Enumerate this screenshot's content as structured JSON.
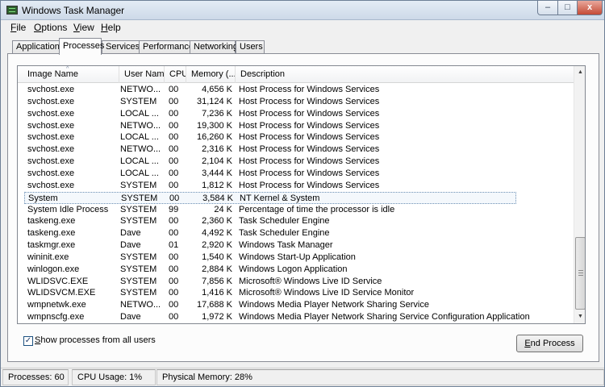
{
  "window": {
    "title": "Windows Task Manager",
    "controls": {
      "minimize": "‒",
      "maximize": "□",
      "close": "x"
    }
  },
  "menu": [
    {
      "key": "F",
      "rest": "ile"
    },
    {
      "key": "O",
      "rest": "ptions"
    },
    {
      "key": "V",
      "rest": "iew"
    },
    {
      "key": "H",
      "rest": "elp"
    }
  ],
  "tabs": [
    "Applications",
    "Processes",
    "Services",
    "Performance",
    "Networking",
    "Users"
  ],
  "active_tab": "Processes",
  "columns": {
    "image_name": "Image Name",
    "user_name": "User Name",
    "cpu": "CPU",
    "memory": "Memory (...",
    "description": "Description"
  },
  "sort_indicator": "^",
  "rows": [
    {
      "name": "svchost.exe",
      "user": "NETWO...",
      "cpu": "00",
      "mem": "4,656 K",
      "desc": "Host Process for Windows Services"
    },
    {
      "name": "svchost.exe",
      "user": "SYSTEM",
      "cpu": "00",
      "mem": "31,124 K",
      "desc": "Host Process for Windows Services"
    },
    {
      "name": "svchost.exe",
      "user": "LOCAL ...",
      "cpu": "00",
      "mem": "7,236 K",
      "desc": "Host Process for Windows Services"
    },
    {
      "name": "svchost.exe",
      "user": "NETWO...",
      "cpu": "00",
      "mem": "19,300 K",
      "desc": "Host Process for Windows Services"
    },
    {
      "name": "svchost.exe",
      "user": "LOCAL ...",
      "cpu": "00",
      "mem": "16,260 K",
      "desc": "Host Process for Windows Services"
    },
    {
      "name": "svchost.exe",
      "user": "NETWO...",
      "cpu": "00",
      "mem": "2,316 K",
      "desc": "Host Process for Windows Services"
    },
    {
      "name": "svchost.exe",
      "user": "LOCAL ...",
      "cpu": "00",
      "mem": "2,104 K",
      "desc": "Host Process for Windows Services"
    },
    {
      "name": "svchost.exe",
      "user": "LOCAL ...",
      "cpu": "00",
      "mem": "3,444 K",
      "desc": "Host Process for Windows Services"
    },
    {
      "name": "svchost.exe",
      "user": "SYSTEM",
      "cpu": "00",
      "mem": "1,812 K",
      "desc": "Host Process for Windows Services"
    },
    {
      "name": "System",
      "user": "SYSTEM",
      "cpu": "00",
      "mem": "3,584 K",
      "desc": "NT Kernel & System",
      "selected": true
    },
    {
      "name": "System Idle Process",
      "user": "SYSTEM",
      "cpu": "99",
      "mem": "24 K",
      "desc": "Percentage of time the processor is idle"
    },
    {
      "name": "taskeng.exe",
      "user": "SYSTEM",
      "cpu": "00",
      "mem": "2,360 K",
      "desc": "Task Scheduler Engine"
    },
    {
      "name": "taskeng.exe",
      "user": "Dave",
      "cpu": "00",
      "mem": "4,492 K",
      "desc": "Task Scheduler Engine"
    },
    {
      "name": "taskmgr.exe",
      "user": "Dave",
      "cpu": "01",
      "mem": "2,920 K",
      "desc": "Windows Task Manager"
    },
    {
      "name": "wininit.exe",
      "user": "SYSTEM",
      "cpu": "00",
      "mem": "1,540 K",
      "desc": "Windows Start-Up Application"
    },
    {
      "name": "winlogon.exe",
      "user": "SYSTEM",
      "cpu": "00",
      "mem": "2,884 K",
      "desc": "Windows Logon Application"
    },
    {
      "name": "WLIDSVC.EXE",
      "user": "SYSTEM",
      "cpu": "00",
      "mem": "7,856 K",
      "desc": "Microsoft® Windows Live ID Service"
    },
    {
      "name": "WLIDSVCM.EXE",
      "user": "SYSTEM",
      "cpu": "00",
      "mem": "1,416 K",
      "desc": "Microsoft® Windows Live ID Service Monitor"
    },
    {
      "name": "wmpnetwk.exe",
      "user": "NETWO...",
      "cpu": "00",
      "mem": "17,688 K",
      "desc": "Windows Media Player Network Sharing Service"
    },
    {
      "name": "wmpnscfg.exe",
      "user": "Dave",
      "cpu": "00",
      "mem": "1,972 K",
      "desc": "Windows Media Player Network Sharing Service Configuration Application"
    }
  ],
  "show_all": {
    "checked": true,
    "mark": "✓",
    "key": "S",
    "rest": "how processes from all users"
  },
  "end_process": {
    "key": "E",
    "rest": "nd Process"
  },
  "status": {
    "processes": "Processes: 60",
    "cpu": "CPU Usage: 1%",
    "memory": "Physical Memory: 28%"
  },
  "colors": {
    "title_gradient_top": "#e4ecf5",
    "close_button": "#c44a35",
    "selection_border": "#6b8fb4"
  }
}
